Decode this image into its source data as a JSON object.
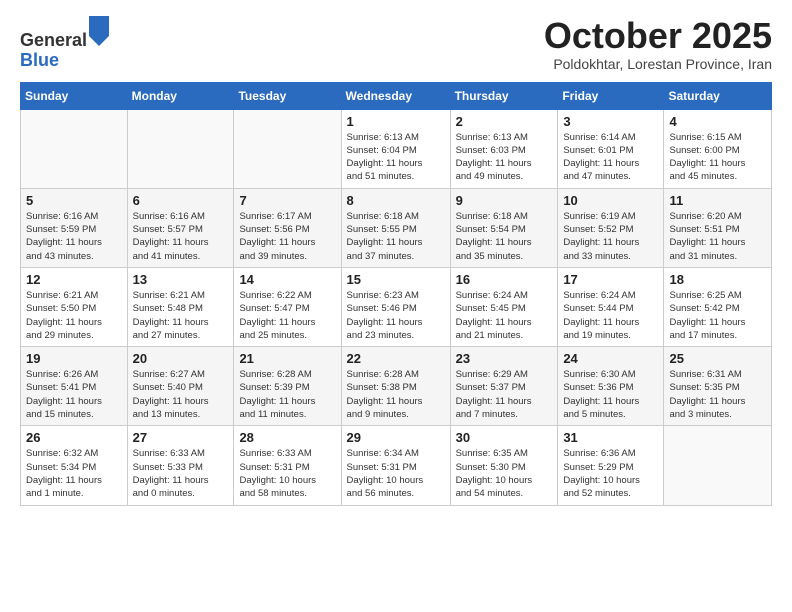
{
  "logo": {
    "general": "General",
    "blue": "Blue"
  },
  "title": "October 2025",
  "subtitle": "Poldokhtar, Lorestan Province, Iran",
  "weekdays": [
    "Sunday",
    "Monday",
    "Tuesday",
    "Wednesday",
    "Thursday",
    "Friday",
    "Saturday"
  ],
  "weeks": [
    [
      {
        "day": "",
        "info": ""
      },
      {
        "day": "",
        "info": ""
      },
      {
        "day": "",
        "info": ""
      },
      {
        "day": "1",
        "info": "Sunrise: 6:13 AM\nSunset: 6:04 PM\nDaylight: 11 hours\nand 51 minutes."
      },
      {
        "day": "2",
        "info": "Sunrise: 6:13 AM\nSunset: 6:03 PM\nDaylight: 11 hours\nand 49 minutes."
      },
      {
        "day": "3",
        "info": "Sunrise: 6:14 AM\nSunset: 6:01 PM\nDaylight: 11 hours\nand 47 minutes."
      },
      {
        "day": "4",
        "info": "Sunrise: 6:15 AM\nSunset: 6:00 PM\nDaylight: 11 hours\nand 45 minutes."
      }
    ],
    [
      {
        "day": "5",
        "info": "Sunrise: 6:16 AM\nSunset: 5:59 PM\nDaylight: 11 hours\nand 43 minutes."
      },
      {
        "day": "6",
        "info": "Sunrise: 6:16 AM\nSunset: 5:57 PM\nDaylight: 11 hours\nand 41 minutes."
      },
      {
        "day": "7",
        "info": "Sunrise: 6:17 AM\nSunset: 5:56 PM\nDaylight: 11 hours\nand 39 minutes."
      },
      {
        "day": "8",
        "info": "Sunrise: 6:18 AM\nSunset: 5:55 PM\nDaylight: 11 hours\nand 37 minutes."
      },
      {
        "day": "9",
        "info": "Sunrise: 6:18 AM\nSunset: 5:54 PM\nDaylight: 11 hours\nand 35 minutes."
      },
      {
        "day": "10",
        "info": "Sunrise: 6:19 AM\nSunset: 5:52 PM\nDaylight: 11 hours\nand 33 minutes."
      },
      {
        "day": "11",
        "info": "Sunrise: 6:20 AM\nSunset: 5:51 PM\nDaylight: 11 hours\nand 31 minutes."
      }
    ],
    [
      {
        "day": "12",
        "info": "Sunrise: 6:21 AM\nSunset: 5:50 PM\nDaylight: 11 hours\nand 29 minutes."
      },
      {
        "day": "13",
        "info": "Sunrise: 6:21 AM\nSunset: 5:48 PM\nDaylight: 11 hours\nand 27 minutes."
      },
      {
        "day": "14",
        "info": "Sunrise: 6:22 AM\nSunset: 5:47 PM\nDaylight: 11 hours\nand 25 minutes."
      },
      {
        "day": "15",
        "info": "Sunrise: 6:23 AM\nSunset: 5:46 PM\nDaylight: 11 hours\nand 23 minutes."
      },
      {
        "day": "16",
        "info": "Sunrise: 6:24 AM\nSunset: 5:45 PM\nDaylight: 11 hours\nand 21 minutes."
      },
      {
        "day": "17",
        "info": "Sunrise: 6:24 AM\nSunset: 5:44 PM\nDaylight: 11 hours\nand 19 minutes."
      },
      {
        "day": "18",
        "info": "Sunrise: 6:25 AM\nSunset: 5:42 PM\nDaylight: 11 hours\nand 17 minutes."
      }
    ],
    [
      {
        "day": "19",
        "info": "Sunrise: 6:26 AM\nSunset: 5:41 PM\nDaylight: 11 hours\nand 15 minutes."
      },
      {
        "day": "20",
        "info": "Sunrise: 6:27 AM\nSunset: 5:40 PM\nDaylight: 11 hours\nand 13 minutes."
      },
      {
        "day": "21",
        "info": "Sunrise: 6:28 AM\nSunset: 5:39 PM\nDaylight: 11 hours\nand 11 minutes."
      },
      {
        "day": "22",
        "info": "Sunrise: 6:28 AM\nSunset: 5:38 PM\nDaylight: 11 hours\nand 9 minutes."
      },
      {
        "day": "23",
        "info": "Sunrise: 6:29 AM\nSunset: 5:37 PM\nDaylight: 11 hours\nand 7 minutes."
      },
      {
        "day": "24",
        "info": "Sunrise: 6:30 AM\nSunset: 5:36 PM\nDaylight: 11 hours\nand 5 minutes."
      },
      {
        "day": "25",
        "info": "Sunrise: 6:31 AM\nSunset: 5:35 PM\nDaylight: 11 hours\nand 3 minutes."
      }
    ],
    [
      {
        "day": "26",
        "info": "Sunrise: 6:32 AM\nSunset: 5:34 PM\nDaylight: 11 hours\nand 1 minute."
      },
      {
        "day": "27",
        "info": "Sunrise: 6:33 AM\nSunset: 5:33 PM\nDaylight: 11 hours\nand 0 minutes."
      },
      {
        "day": "28",
        "info": "Sunrise: 6:33 AM\nSunset: 5:31 PM\nDaylight: 10 hours\nand 58 minutes."
      },
      {
        "day": "29",
        "info": "Sunrise: 6:34 AM\nSunset: 5:31 PM\nDaylight: 10 hours\nand 56 minutes."
      },
      {
        "day": "30",
        "info": "Sunrise: 6:35 AM\nSunset: 5:30 PM\nDaylight: 10 hours\nand 54 minutes."
      },
      {
        "day": "31",
        "info": "Sunrise: 6:36 AM\nSunset: 5:29 PM\nDaylight: 10 hours\nand 52 minutes."
      },
      {
        "day": "",
        "info": ""
      }
    ]
  ]
}
